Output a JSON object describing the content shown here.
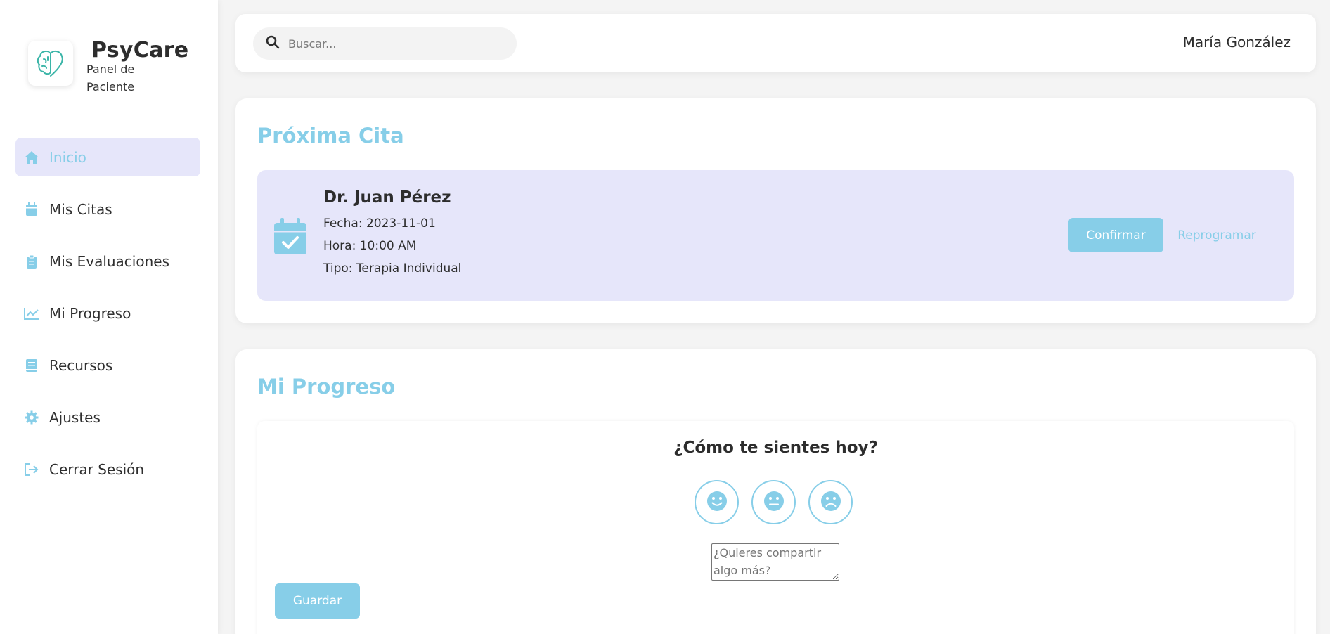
{
  "brand": {
    "title": "PsyCare",
    "subtitle": "Panel de Paciente",
    "logo_icon": "brain-heart-icon"
  },
  "sidebar": {
    "items": [
      {
        "label": "Inicio",
        "icon": "home-icon",
        "active": true
      },
      {
        "label": "Mis Citas",
        "icon": "calendar-icon"
      },
      {
        "label": "Mis Evaluaciones",
        "icon": "clipboard-icon"
      },
      {
        "label": "Mi Progreso",
        "icon": "chart-line-icon"
      },
      {
        "label": "Recursos",
        "icon": "book-icon"
      },
      {
        "label": "Ajustes",
        "icon": "gear-icon"
      },
      {
        "label": "Cerrar Sesión",
        "icon": "sign-out-icon"
      }
    ]
  },
  "header": {
    "search_placeholder": "Buscar...",
    "user_name": "María González"
  },
  "next_appointment": {
    "title": "Próxima Cita",
    "doctor": "Dr. Juan Pérez",
    "date": "Fecha: 2023-11-01",
    "time": "Hora: 10:00 AM",
    "type": "Tipo: Terapia Individual",
    "confirm_label": "Confirmar",
    "reschedule_label": "Reprogramar"
  },
  "progress": {
    "title": "Mi Progreso",
    "question": "¿Cómo te sientes hoy?",
    "moods": [
      "happy",
      "neutral",
      "sad"
    ],
    "note_placeholder": "¿Quieres compartir algo más?",
    "save_label": "Guardar"
  },
  "colors": {
    "accent": "#87cee8",
    "active_bg": "#e6e6fa",
    "logo_teal": "#3bb5a8"
  }
}
